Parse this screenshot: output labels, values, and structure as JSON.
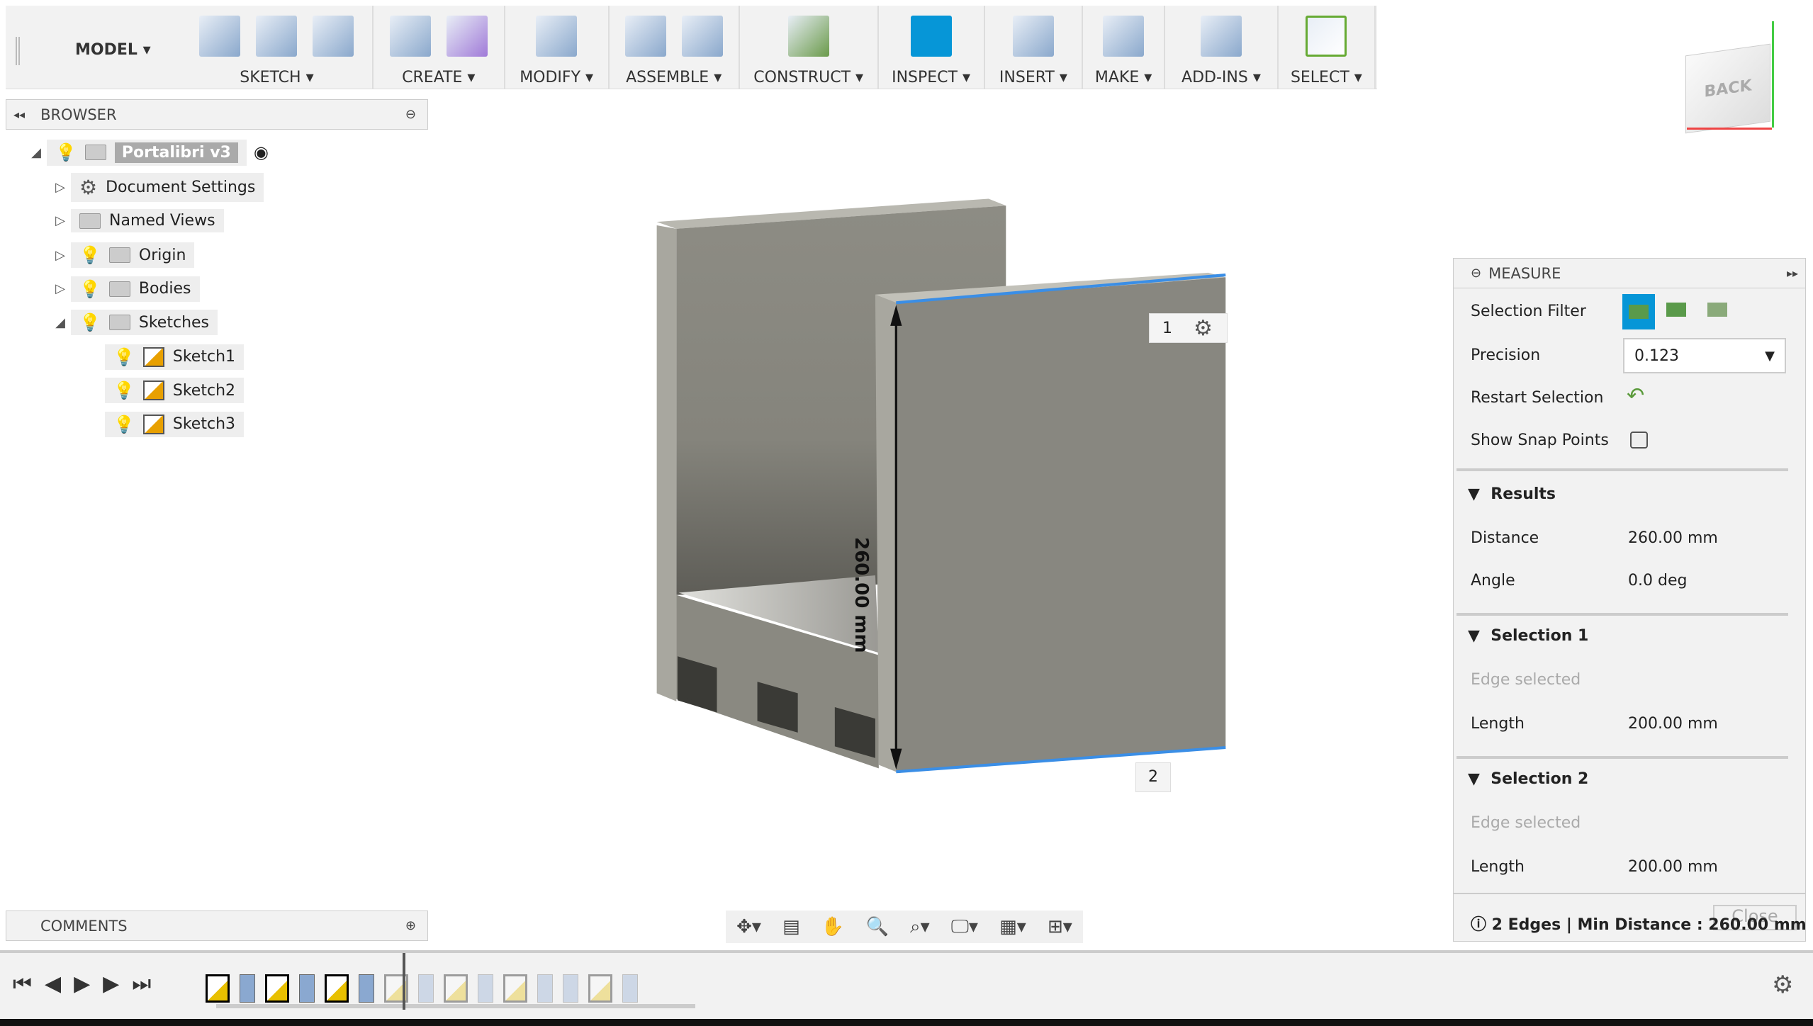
{
  "toolbar": {
    "workspace": "MODEL",
    "groups": [
      {
        "label": "SKETCH",
        "icons": [
          "create-sketch-icon",
          "spline-icon",
          "rectangle-icon"
        ]
      },
      {
        "label": "CREATE",
        "icons": [
          "extrude-icon",
          "form-icon"
        ]
      },
      {
        "label": "MODIFY",
        "icons": [
          "press-pull-icon"
        ]
      },
      {
        "label": "ASSEMBLE",
        "icons": [
          "new-component-icon",
          "joint-icon"
        ]
      },
      {
        "label": "CONSTRUCT",
        "icons": [
          "offset-plane-icon"
        ]
      },
      {
        "label": "INSPECT",
        "icons": [
          "measure-icon"
        ]
      },
      {
        "label": "INSERT",
        "icons": [
          "insert-image-icon"
        ]
      },
      {
        "label": "MAKE",
        "icons": [
          "3d-print-icon"
        ]
      },
      {
        "label": "ADD-INS",
        "icons": [
          "scripts-icon"
        ]
      },
      {
        "label": "SELECT",
        "icons": [
          "select-icon"
        ]
      }
    ]
  },
  "browser": {
    "title": "BROWSER",
    "items": [
      {
        "label": "Portalibri v3",
        "level": 0,
        "expanded": true
      },
      {
        "label": "Document Settings",
        "level": 1
      },
      {
        "label": "Named Views",
        "level": 1
      },
      {
        "label": "Origin",
        "level": 1
      },
      {
        "label": "Bodies",
        "level": 1
      },
      {
        "label": "Sketches",
        "level": 1,
        "expanded": true
      },
      {
        "label": "Sketch1",
        "level": 2
      },
      {
        "label": "Sketch2",
        "level": 2
      },
      {
        "label": "Sketch3",
        "level": 2
      }
    ]
  },
  "viewcube": {
    "face": "BACK"
  },
  "viewport": {
    "dimension": "260.00 mm",
    "label1": "1",
    "label2": "2"
  },
  "measure": {
    "title": "MEASURE",
    "selection_filter": "Selection Filter",
    "precision_label": "Precision",
    "precision_value": "0.123",
    "restart": "Restart Selection",
    "snap": "Show Snap Points",
    "snap_checked": false,
    "results": {
      "title": "Results",
      "distance_label": "Distance",
      "distance": "260.00 mm",
      "angle_label": "Angle",
      "angle": "0.0 deg"
    },
    "sel1": {
      "title": "Selection 1",
      "type": "Edge selected",
      "length_label": "Length",
      "length": "200.00 mm"
    },
    "sel2": {
      "title": "Selection 2",
      "type": "Edge selected",
      "length_label": "Length",
      "length": "200.00 mm"
    },
    "status": "2 Edges | Min Distance : 260.00 mm",
    "close": "Close"
  },
  "comments": {
    "title": "COMMENTS"
  },
  "accent": "#0696d7",
  "selection_color": "#3a8ee6"
}
